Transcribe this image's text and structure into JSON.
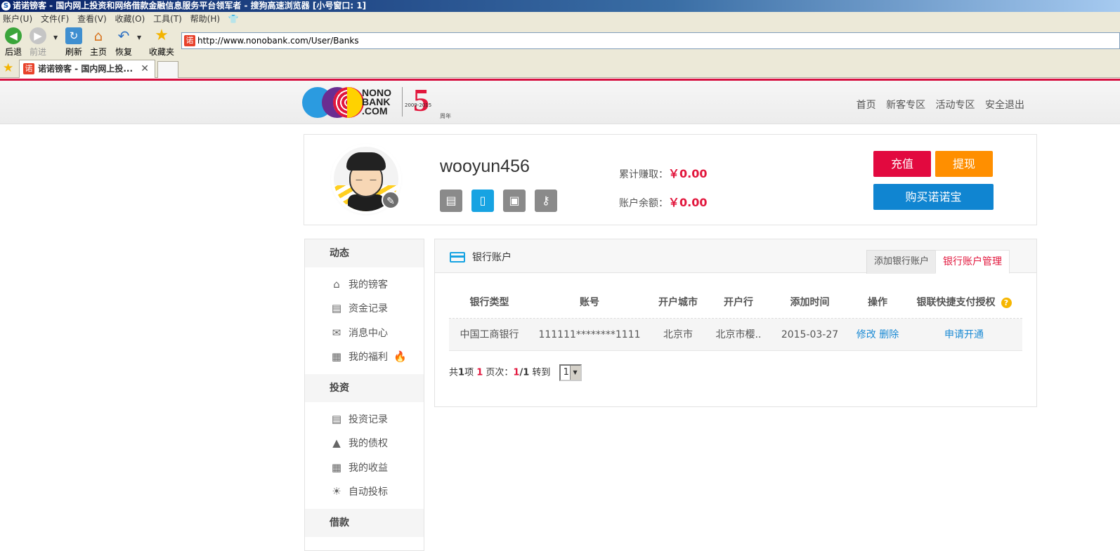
{
  "window": {
    "title": "诺诺镑客 - 国内网上投资和网络借款金融信息服务平台领军者 - 搜狗高速浏览器 [小号窗口: 1]"
  },
  "menubar": [
    "账户(U)",
    "文件(F)",
    "查看(V)",
    "收藏(O)",
    "工具(T)",
    "帮助(H)"
  ],
  "toolbar": {
    "back": "后退",
    "forward": "前进",
    "refresh": "刷新",
    "home": "主页",
    "restore": "恢复",
    "favorites": "收藏夹"
  },
  "address_bar": {
    "url": "http://www.nonobank.com/User/Banks"
  },
  "tabs": [
    {
      "label": "诺诺镑客 - 国内网上投..."
    }
  ],
  "site": {
    "logo_text": "NONO BANK .COM",
    "logo_years": "2009-2015",
    "logo_five": "5",
    "logo_anniversary": "周年",
    "nav": [
      "首页",
      "新客专区",
      "活动专区",
      "安全退出"
    ]
  },
  "profile": {
    "username": "wooyun456",
    "total_earned_label": "累计赚取：",
    "total_earned_value": "￥0.00",
    "balance_label": "账户余额：",
    "balance_value": "￥0.00",
    "recharge_label": "充值",
    "withdraw_label": "提现",
    "buy_label": "购买诺诺宝"
  },
  "sidebar": {
    "sections": [
      {
        "title": "动态",
        "items": [
          "我的镑客",
          "资金记录",
          "消息中心",
          "我的福利"
        ]
      },
      {
        "title": "投资",
        "items": [
          "投资记录",
          "我的债权",
          "我的收益",
          "自动投标"
        ]
      },
      {
        "title": "借款",
        "items": []
      }
    ]
  },
  "main": {
    "title": "银行账户",
    "tab_add": "添加银行账户",
    "tab_manage": "银行账户管理",
    "columns": [
      "银行类型",
      "账号",
      "开户城市",
      "开户行",
      "添加时间",
      "操作",
      "银联快捷支付授权"
    ],
    "rows": [
      {
        "type": "中国工商银行",
        "account": "111111********1111",
        "city": "北京市",
        "bank": "北京市樱..",
        "time": "2015-03-27",
        "edit": "修改",
        "delete": "删除",
        "auth": "申请开通"
      }
    ],
    "pager": {
      "prefix": "共",
      "total": "1",
      "unit": "项",
      "current": "1",
      "page_label": "页次：",
      "page_current": "1",
      "page_total": "/1",
      "goto": "转到",
      "select_value": "1"
    }
  },
  "colors": {
    "brand_red": "#e2173d",
    "accent_orange": "#ff8f00",
    "accent_blue": "#1085d1",
    "link_blue": "#1a8ad4"
  }
}
